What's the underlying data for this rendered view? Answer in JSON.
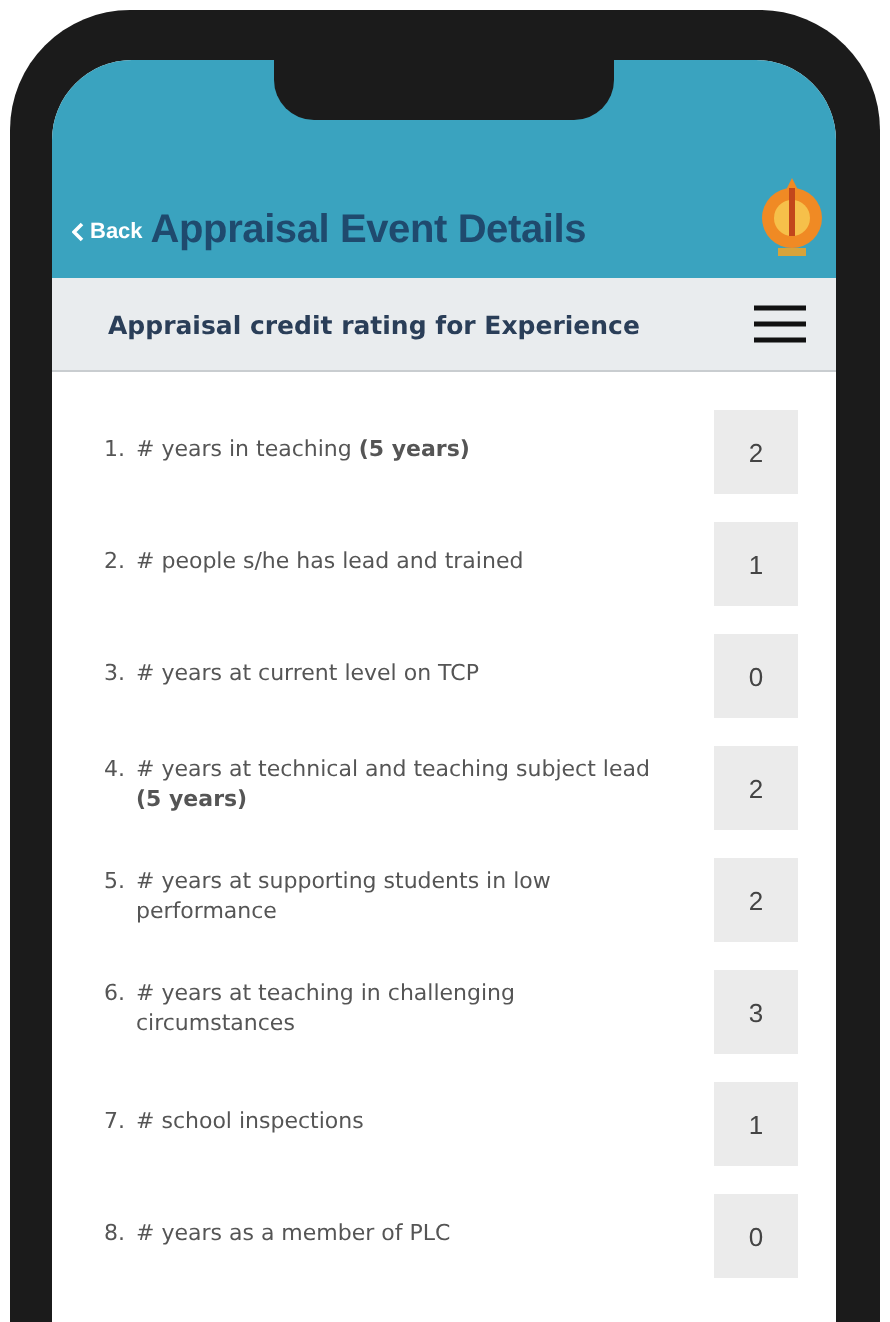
{
  "header": {
    "back": "Back",
    "title": "Appraisal Event Details"
  },
  "subheader": {
    "title": "Appraisal credit rating for Experience"
  },
  "items": [
    {
      "number": "1.",
      "text": "# years in teaching  **(5 years)**",
      "value": "2"
    },
    {
      "number": "2.",
      "text": "# people s/he has lead and trained",
      "value": "1"
    },
    {
      "number": "3.",
      "text": "# years at current level on TCP",
      "value": "0"
    },
    {
      "number": "4.",
      "text": "# years at technical and teaching subject lead  **(5 years)**",
      "value": "2"
    },
    {
      "number": "5.",
      "text": "# years at supporting students in low performance",
      "value": "2"
    },
    {
      "number": "6.",
      "text": "# years at teaching in challenging circumstances",
      "value": "3"
    },
    {
      "number": "7.",
      "text": "# school inspections",
      "value": "1"
    },
    {
      "number": "8.",
      "text": "# years as a member of PLC",
      "value": "0"
    }
  ]
}
